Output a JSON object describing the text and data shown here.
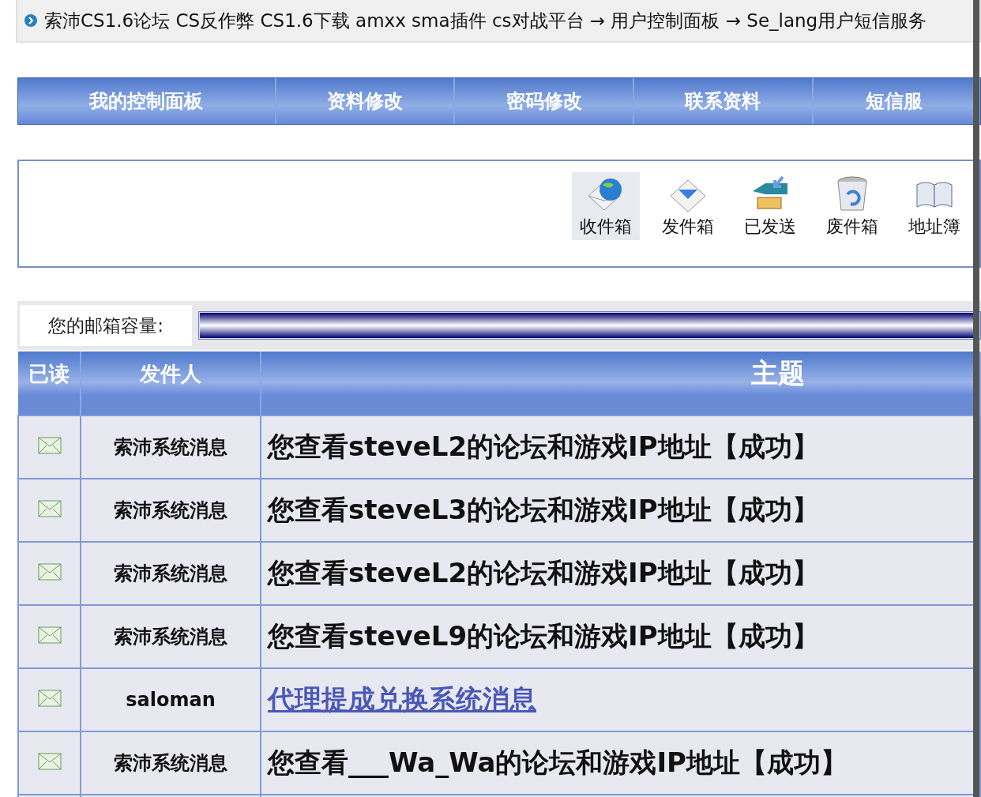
{
  "breadcrumb": {
    "text": "索沛CS1.6论坛 CS反作弊 CS1.6下载 amxx sma插件 cs对战平台 → 用户控制面板 → Se_lang用户短信服务"
  },
  "nav_tabs": [
    "我的控制面板",
    "资料修改",
    "密码修改",
    "联系资料",
    "短信服"
  ],
  "mail_toolbar": [
    {
      "label": "收件箱",
      "selected": true
    },
    {
      "label": "发件箱",
      "selected": false
    },
    {
      "label": "已发送",
      "selected": false
    },
    {
      "label": "废件箱",
      "selected": false
    },
    {
      "label": "地址簿",
      "selected": false
    }
  ],
  "capacity": {
    "label": "您的邮箱容量:",
    "level": 1
  },
  "table": {
    "columns": [
      "已读",
      "发件人",
      "主题"
    ],
    "rows": [
      {
        "sender": "索沛系统消息",
        "subject": "您查看steveL2的论坛和游戏IP地址【成功】",
        "kind": "text"
      },
      {
        "sender": "索沛系统消息",
        "subject": "您查看steveL3的论坛和游戏IP地址【成功】",
        "kind": "text"
      },
      {
        "sender": "索沛系统消息",
        "subject": "您查看steveL2的论坛和游戏IP地址【成功】",
        "kind": "text"
      },
      {
        "sender": "索沛系统消息",
        "subject": "您查看steveL9的论坛和游戏IP地址【成功】",
        "kind": "text"
      },
      {
        "sender": "saloman",
        "subject": "代理提成兑换系统消息",
        "kind": "link"
      },
      {
        "sender": "索沛系统消息",
        "subject": "您查看___Wa_Wa的论坛和游戏IP地址【成功】",
        "kind": "text"
      }
    ]
  }
}
